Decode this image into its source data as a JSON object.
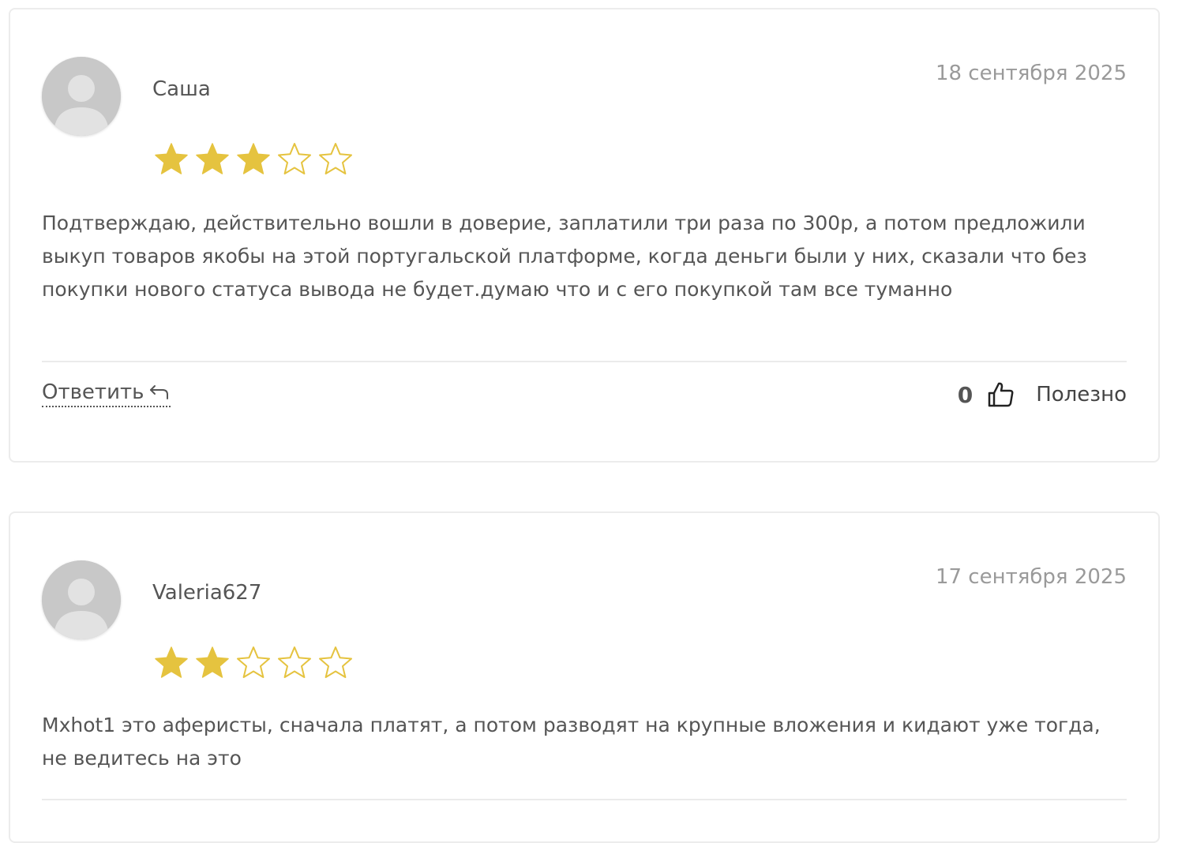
{
  "colors": {
    "star_filled": "#e5c33f",
    "star_empty": "#e5c33f",
    "avatar_bg": "#d2d2d2",
    "date_text": "#9a9a9a",
    "card_border": "#ececec"
  },
  "reviews": [
    {
      "author": "Саша",
      "date": "18 сентября 2025",
      "rating": 3,
      "rating_max": 5,
      "text": "Подтверждаю, действительно вошли в доверие, заплатили три раза по 300р, а потом предложили выкуп товаров якобы на этой португальской платформе, когда деньги были у них, сказали что без покупки нового статуса вывода не будет.думаю что и с его покупкой там все туманно",
      "reply_label": "Ответить",
      "like_count": "0",
      "helpful_label": "Полезно"
    },
    {
      "author": "Valeria627",
      "date": "17 сентября 2025",
      "rating": 2,
      "rating_max": 5,
      "text": "Mxhot1 это аферисты, сначала платят, а потом разводят на крупные вложения и кидают уже тогда, не ведитесь на это"
    }
  ],
  "icons": {
    "avatar": "user-placeholder-icon",
    "reply": "reply-arrow-icon",
    "like": "thumbs-up-icon",
    "star": "star-icon"
  }
}
